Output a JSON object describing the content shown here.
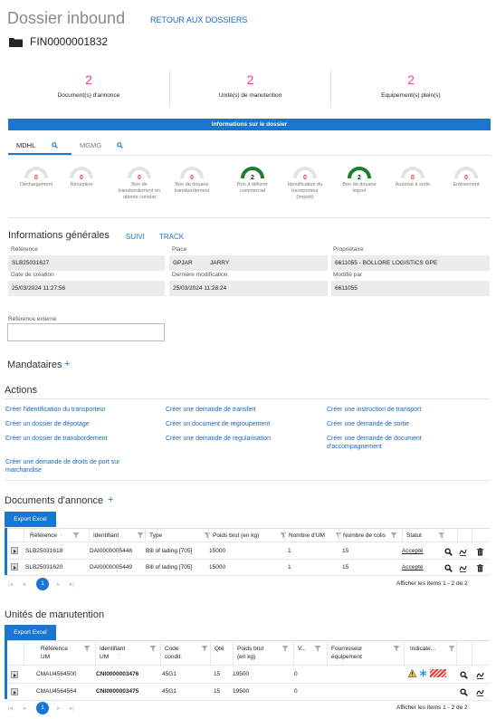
{
  "header": {
    "title": "Dossier inbound",
    "back_link": "RETOUR AUX DOSSIERS",
    "dossier_id": "FIN0000001832"
  },
  "stats": [
    {
      "value": "2",
      "label": "Document(s) d'annonce"
    },
    {
      "value": "2",
      "label": "Unité(s) de manutention"
    },
    {
      "value": "2",
      "label": "Equipement(s) plein(s)"
    }
  ],
  "info_bar": "Informations sur le dossier",
  "tabs": [
    {
      "label": "MDHL"
    },
    {
      "label": "MGMG"
    }
  ],
  "gauges": [
    {
      "value": "0",
      "level": 0,
      "label": [
        "Déchargement"
      ]
    },
    {
      "value": "0",
      "level": 0,
      "label": [
        "Réception"
      ]
    },
    {
      "value": "0",
      "level": 0,
      "label": [
        "Bon de",
        "transbordement en",
        "attente constat"
      ]
    },
    {
      "value": "0",
      "level": 0,
      "label": [
        "Bon de douane",
        "transbordement"
      ]
    },
    {
      "value": "2",
      "level": 1,
      "label": [
        "Bon à délivrer",
        "commercial"
      ]
    },
    {
      "value": "0",
      "level": 0,
      "label": [
        "Identification du",
        "transporteur",
        "(Import)"
      ]
    },
    {
      "value": "2",
      "level": 1,
      "label": [
        "Bon de douane",
        "import"
      ]
    },
    {
      "value": "0",
      "level": 0,
      "label": [
        "Autorisé à sortir"
      ]
    },
    {
      "value": "0",
      "level": 0,
      "label": [
        "Enlèvement"
      ]
    }
  ],
  "colors": {
    "accent": "#1976d2",
    "pink": "#e0458e",
    "gauge_on": "#1e7d32",
    "gauge_off": "#e3e3e3",
    "gauge_zero": "#e53935"
  },
  "general": {
    "title": "Informations générales",
    "links": [
      "SUIVI",
      "TRACK"
    ],
    "reference_label": "Référence",
    "reference": "SLB25031627",
    "place_label": "Place",
    "place_code": "GPJAR",
    "place_name": "JARRY",
    "owner_label": "Propriétaire",
    "owner": "6611055 - BOLLORE LOGISTICS GPE",
    "created_label": "Date de création",
    "created": "25/03/2024 11:27:56",
    "modified_label": "Dernière modification",
    "modified": "25/03/2024 11:28:24",
    "modified_by_label": "Modifié par",
    "modified_by": "6611055",
    "ext_ref_label": "Référence externe",
    "ext_ref_value": ""
  },
  "mandataires": {
    "title": "Mandataires",
    "add": "+"
  },
  "actions": {
    "title": "Actions",
    "col1": [
      "Créer l'identification du transporteur",
      "Créer un dossier de dépotage",
      "Créer un dossier de transbordement",
      "Créer une demande de droits de port sur marchandise"
    ],
    "col2": [
      "Créer une demande de transfert",
      "Créer un document de regroupement",
      "Créer une demande de regularisation"
    ],
    "col3": [
      "Créer une instruction de transport",
      "Créer une demande de sortie",
      "Créer une demande de document d'accompagnement"
    ]
  },
  "documents": {
    "title": "Documents d'annonce",
    "add": "+",
    "export": "Export Excel",
    "headers": [
      "Référence",
      "Identifiant",
      "Type",
      "Poids brut (en kg)",
      "Nombre d'UM",
      "Nombre de colis",
      "Statut"
    ],
    "rows": [
      {
        "ref": "SLB25031618",
        "id": "DAI0000005448",
        "type": "Bill of lading [705]",
        "poids": "15000",
        "um": "1",
        "colis": "15",
        "statut": "Accepté"
      },
      {
        "ref": "SLB25031620",
        "id": "DAI0000005449",
        "type": "Bill of lading [705]",
        "poids": "15000",
        "um": "1",
        "colis": "15",
        "statut": "Accepté"
      }
    ],
    "pager": {
      "page": "1",
      "info": "Afficher les items 1 - 2 de 2"
    }
  },
  "units": {
    "title": "Unités de manutention",
    "export": "Export Excel",
    "headers": {
      "ref": [
        "Référence",
        "UM"
      ],
      "id": [
        "Identifiant",
        "UM"
      ],
      "code": [
        "Code",
        "condit."
      ],
      "qte": "Qté",
      "poids": [
        "Poids brut",
        "(en kg)"
      ],
      "v": "V...",
      "fourn": [
        "Fournisseur",
        "équipement"
      ],
      "ind": "Indicate..."
    },
    "rows": [
      {
        "ref": "CMAU4564500",
        "id": "CNI0000003476",
        "code": "45G1",
        "qte": "15",
        "poids": "19500",
        "v": "0",
        "indicators": true
      },
      {
        "ref": "CMAU4564564",
        "id": "CNI0000003475",
        "code": "45G1",
        "qte": "15",
        "poids": "19500",
        "v": "0",
        "indicators": false
      }
    ],
    "pager": {
      "page": "1",
      "info": "Afficher les items 1 - 2 de 2"
    }
  }
}
